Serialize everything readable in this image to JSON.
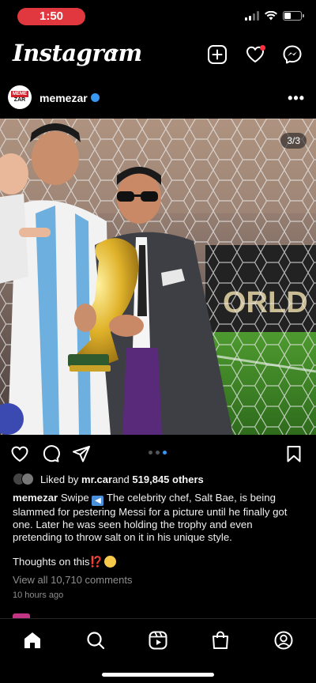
{
  "status": {
    "time": "1:50"
  },
  "app": {
    "logo": "Instagram"
  },
  "post": {
    "username": "memezar",
    "avatar_text_top": "MEME",
    "avatar_text_bottom": "ZAR",
    "carousel_counter": "3/3",
    "liked_by_prefix": "Liked by ",
    "liked_by_user": "mr.car",
    "liked_by_mid": " and ",
    "liked_by_count": "519,845 others",
    "caption_user": "memezar",
    "caption_swipe": " Swipe ",
    "caption_text": " The celebrity chef, Salt Bae, is being slammed for pestering Messi for a picture until he finally got one. Later he was seen holding the trophy and even pretending to throw salt on it in his unique style.",
    "thoughts_text": "Thoughts on this",
    "thoughts_mark": "⁉️",
    "view_comments": "View all 10,710 comments",
    "time_ago": "10 hours ago",
    "carousel_dots": 3,
    "carousel_active": 3
  },
  "colors": {
    "accent_blue": "#3897f0",
    "notification_red": "#ff3040",
    "time_pill": "#e0383e"
  },
  "icons": {
    "header": [
      "plus-square-icon",
      "heart-icon",
      "messenger-icon"
    ],
    "actions": [
      "heart-icon",
      "comment-icon",
      "share-icon",
      "bookmark-icon"
    ],
    "nav": [
      "home-icon",
      "search-icon",
      "reels-icon",
      "shop-icon",
      "profile-icon"
    ]
  }
}
